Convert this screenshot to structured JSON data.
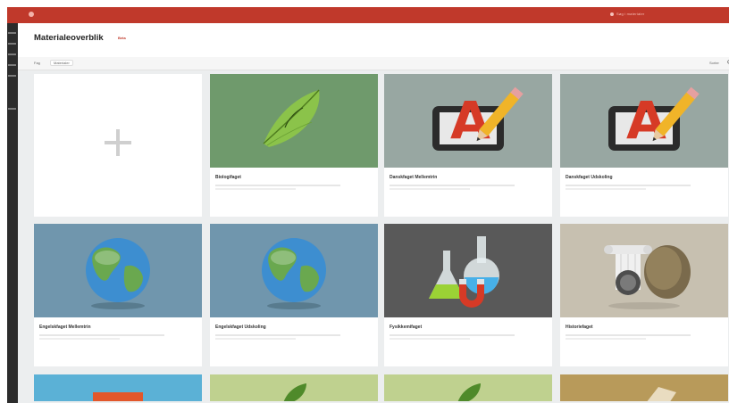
{
  "header": {
    "title": "Materialeoverblik",
    "badge": "Beta"
  },
  "topbar": {
    "search_text": "Søg i materialer"
  },
  "toolbar": {
    "crumb_first": "Fag",
    "crumb_second": "Materialer",
    "sort_label": "Sorter"
  },
  "add_card": {
    "icon": "plus-icon"
  },
  "cards": [
    {
      "title": "Biologifaget",
      "image": "leaf",
      "bg": "#6f9a6c"
    },
    {
      "title": "Danskfaget Mellemtrin",
      "image": "letter-a-pencil",
      "bg": "#98a7a2"
    },
    {
      "title": "Danskfaget Udskoling",
      "image": "letter-a-pencil",
      "bg": "#98a7a2"
    },
    {
      "title": "Engelskfaget Mellemtrin",
      "image": "globe",
      "bg": "#7096ad"
    },
    {
      "title": "Engelskfaget Udskoling",
      "image": "globe",
      "bg": "#7096ad"
    },
    {
      "title": "Fysikkemifaget",
      "image": "flasks-magnet",
      "bg": "#595959"
    },
    {
      "title": "Historiefaget",
      "image": "column-shield",
      "bg": "#c7c0b0"
    }
  ],
  "colors": {
    "accent": "#c0392b",
    "sidebar": "#2c2c2c",
    "page_bg": "#eceeef"
  }
}
